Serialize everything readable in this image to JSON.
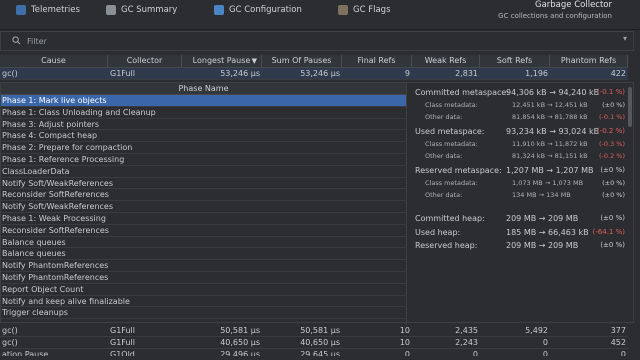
{
  "tabs": [
    {
      "label": "Telemetries",
      "icon": "telemetries-icon"
    },
    {
      "label": "GC Summary",
      "icon": "gc-summary-icon"
    },
    {
      "label": "GC Configuration",
      "icon": "gc-configuration-icon"
    },
    {
      "label": "GC Flags",
      "icon": "gc-flags-icon"
    }
  ],
  "header": {
    "title": "Garbage Collector",
    "subtitle": "GC collections and configuration"
  },
  "filter": {
    "placeholder": "Filter",
    "dropdown_glyph": "▾"
  },
  "table": {
    "columns": [
      "Cause",
      "Collector",
      "Longest Pause",
      "Sum Of Pauses",
      "Final Refs",
      "Weak Refs",
      "Soft Refs",
      "Phantom Refs"
    ],
    "sort_indicator": "▼",
    "rows": [
      {
        "cause": "gc()",
        "collector": "G1Full",
        "longest": "53,246 µs",
        "sum": "53,246 µs",
        "final": "9",
        "weak": "2,831",
        "soft": "1,196",
        "phantom": "422"
      }
    ],
    "bottom_rows": [
      {
        "cause": "gc()",
        "collector": "G1Full",
        "longest": "50,581 µs",
        "sum": "50,581 µs",
        "final": "10",
        "weak": "2,435",
        "soft": "5,492",
        "phantom": "377"
      },
      {
        "cause": "gc()",
        "collector": "G1Full",
        "longest": "40,650 µs",
        "sum": "40,650 µs",
        "final": "10",
        "weak": "2,243",
        "soft": "0",
        "phantom": "452"
      },
      {
        "cause": "ation Pause",
        "collector": "G1Old",
        "longest": "29,496 µs",
        "sum": "29,645 µs",
        "final": "0",
        "weak": "0",
        "soft": "0",
        "phantom": "0"
      }
    ]
  },
  "phases": {
    "header": "Phase Name",
    "items": [
      "Phase 1: Mark live objects",
      "Phase 1: Class Unloading and Cleanup",
      "Phase 3: Adjust pointers",
      "Phase 4: Compact heap",
      "Phase 2: Prepare for compaction",
      "Phase 1: Reference Processing",
      "ClassLoaderData",
      "Notify Soft/WeakReferences",
      "Reconsider SoftReferences",
      "Notify Soft/WeakReferences",
      "Phase 1: Weak Processing",
      "Reconsider SoftReferences",
      "Balance queues",
      "Balance queues",
      "Notify PhantomReferences",
      "Notify PhantomReferences",
      "Report Object Count",
      "Notify and keep alive finalizable",
      "Trigger cleanups"
    ]
  },
  "details": [
    {
      "label": "Committed metaspace:",
      "value": "94,306 kB → 94,240 kB",
      "pct": "(-0.1 %)",
      "neg": true,
      "small": false
    },
    {
      "label": "Class metadata:",
      "value": "12,451 kB → 12,451 kB",
      "pct": "(±0 %)",
      "neg": false,
      "small": true
    },
    {
      "label": "Other data:",
      "value": "81,854 kB → 81,788 kB",
      "pct": "(-0.1 %)",
      "neg": true,
      "small": true
    },
    {
      "label": "Used metaspace:",
      "value": "93,234 kB → 93,024 kB",
      "pct": "(-0.2 %)",
      "neg": true,
      "small": false
    },
    {
      "label": "Class metadata:",
      "value": "11,910 kB → 11,872 kB",
      "pct": "(-0.3 %)",
      "neg": true,
      "small": true
    },
    {
      "label": "Other data:",
      "value": "81,324 kB → 81,151 kB",
      "pct": "(-0.2 %)",
      "neg": true,
      "small": true
    },
    {
      "label": "Reserved metaspace:",
      "value": "1,207 MB → 1,207 MB",
      "pct": "(±0 %)",
      "neg": false,
      "small": false
    },
    {
      "label": "Class metadata:",
      "value": "1,073 MB → 1,073 MB",
      "pct": "(±0 %)",
      "neg": false,
      "small": true
    },
    {
      "label": "Other data:",
      "value": "134 MB → 134 MB",
      "pct": "(±0 %)",
      "neg": false,
      "small": true
    },
    {
      "label": "Committed heap:",
      "value": "209 MB → 209 MB",
      "pct": "(±0 %)",
      "neg": false,
      "small": false
    },
    {
      "label": "Used heap:",
      "value": "185 MB → 66,463 kB",
      "pct": "(-64.1 %)",
      "neg": true,
      "small": false
    },
    {
      "label": "Reserved heap:",
      "value": "209 MB → 209 MB",
      "pct": "(±0 %)",
      "neg": false,
      "small": false
    }
  ]
}
